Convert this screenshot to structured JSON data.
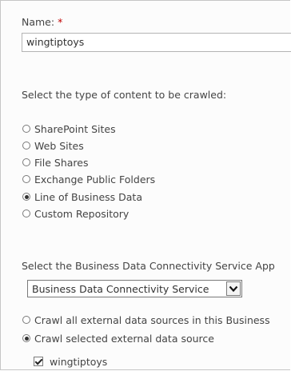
{
  "name_field": {
    "label": "Name:",
    "required_marker": "*",
    "value": "wingtiptoys"
  },
  "content_type": {
    "prompt": "Select the type of content to be crawled:",
    "options": [
      {
        "label": "SharePoint Sites",
        "selected": false
      },
      {
        "label": "Web Sites",
        "selected": false
      },
      {
        "label": "File Shares",
        "selected": false
      },
      {
        "label": "Exchange Public Folders",
        "selected": false
      },
      {
        "label": "Line of Business Data",
        "selected": true
      },
      {
        "label": "Custom Repository",
        "selected": false
      }
    ]
  },
  "bdc": {
    "prompt": "Select the Business Data Connectivity Service App",
    "selected_value": "Business Data Connectivity Service",
    "dropdown_icon": "chevron-down-icon"
  },
  "crawl_scope": {
    "options": [
      {
        "label": "Crawl all external data sources in this Business",
        "selected": false
      },
      {
        "label": "Crawl selected external data source",
        "selected": true
      }
    ]
  },
  "external_sources": [
    {
      "label": "wingtiptoys",
      "checked": true
    }
  ],
  "colors": {
    "required": "#c00000",
    "text": "#444444",
    "border": "#b4b4b4"
  }
}
